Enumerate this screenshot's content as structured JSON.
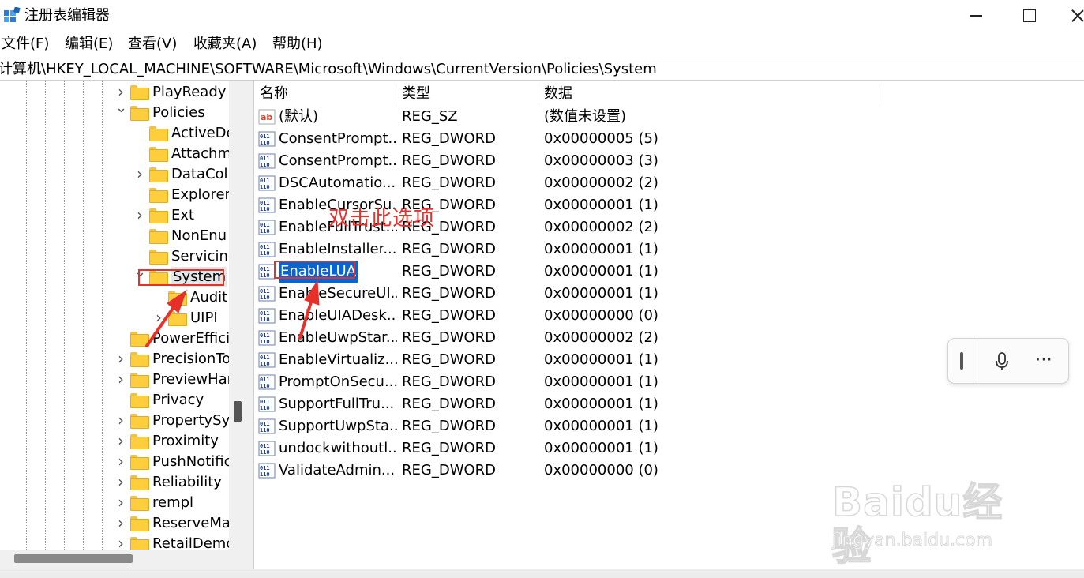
{
  "window": {
    "title": "注册表编辑器"
  },
  "menu": [
    "文件(F)",
    "编辑(E)",
    "查看(V)",
    "收藏夹(A)",
    "帮助(H)"
  ],
  "address": "计算机\\HKEY_LOCAL_MACHINE\\SOFTWARE\\Microsoft\\Windows\\CurrentVersion\\Policies\\System",
  "tree": [
    {
      "label": "PlayReady",
      "level": 0,
      "chevron": "right"
    },
    {
      "label": "Policies",
      "level": 0,
      "chevron": "down"
    },
    {
      "label": "ActiveDe",
      "level": 1,
      "chevron": "none"
    },
    {
      "label": "Attachm",
      "level": 1,
      "chevron": "none"
    },
    {
      "label": "DataCol",
      "level": 1,
      "chevron": "right"
    },
    {
      "label": "Explorer",
      "level": 1,
      "chevron": "none"
    },
    {
      "label": "Ext",
      "level": 1,
      "chevron": "right"
    },
    {
      "label": "NonEnu",
      "level": 1,
      "chevron": "none"
    },
    {
      "label": "Servicing",
      "level": 1,
      "chevron": "none"
    },
    {
      "label": "System",
      "level": 1,
      "chevron": "down",
      "selected": true
    },
    {
      "label": "Audit",
      "level": 2,
      "chevron": "none"
    },
    {
      "label": "UIPI",
      "level": 2,
      "chevron": "right"
    },
    {
      "label": "PowerEffici",
      "level": 0,
      "chevron": "none"
    },
    {
      "label": "PrecisionTo",
      "level": 0,
      "chevron": "right"
    },
    {
      "label": "PreviewHar",
      "level": 0,
      "chevron": "right"
    },
    {
      "label": "Privacy",
      "level": 0,
      "chevron": "none"
    },
    {
      "label": "PropertySy",
      "level": 0,
      "chevron": "right"
    },
    {
      "label": "Proximity",
      "level": 0,
      "chevron": "right"
    },
    {
      "label": "PushNotific",
      "level": 0,
      "chevron": "right"
    },
    {
      "label": "Reliability",
      "level": 0,
      "chevron": "right"
    },
    {
      "label": "rempl",
      "level": 0,
      "chevron": "right"
    },
    {
      "label": "ReserveMa",
      "level": 0,
      "chevron": "right"
    },
    {
      "label": "RetailDemo",
      "level": 0,
      "chevron": "right"
    }
  ],
  "columns": [
    "名称",
    "类型",
    "数据"
  ],
  "values": [
    {
      "name": "(默认)",
      "type": "REG_SZ",
      "data": "(数值未设置)",
      "icon": "string-value-icon"
    },
    {
      "name": "ConsentPrompt...",
      "type": "REG_DWORD",
      "data": "0x00000005 (5)",
      "icon": "dword-value-icon"
    },
    {
      "name": "ConsentPrompt...",
      "type": "REG_DWORD",
      "data": "0x00000003 (3)",
      "icon": "dword-value-icon"
    },
    {
      "name": "DSCAutomatio...",
      "type": "REG_DWORD",
      "data": "0x00000002 (2)",
      "icon": "dword-value-icon"
    },
    {
      "name": "EnableCursorSu...",
      "type": "REG_DWORD",
      "data": "0x00000001 (1)",
      "icon": "dword-value-icon"
    },
    {
      "name": "EnableFullTrust...",
      "type": "REG_DWORD",
      "data": "0x00000002 (2)",
      "icon": "dword-value-icon"
    },
    {
      "name": "EnableInstaller...",
      "type": "REG_DWORD",
      "data": "0x00000001 (1)",
      "icon": "dword-value-icon"
    },
    {
      "name": "EnableLUA",
      "type": "REG_DWORD",
      "data": "0x00000001 (1)",
      "icon": "dword-value-icon",
      "selected": true
    },
    {
      "name": "EnableSecureUI...",
      "type": "REG_DWORD",
      "data": "0x00000001 (1)",
      "icon": "dword-value-icon"
    },
    {
      "name": "EnableUIADesk...",
      "type": "REG_DWORD",
      "data": "0x00000000 (0)",
      "icon": "dword-value-icon"
    },
    {
      "name": "EnableUwpStar...",
      "type": "REG_DWORD",
      "data": "0x00000002 (2)",
      "icon": "dword-value-icon"
    },
    {
      "name": "EnableVirtualiz...",
      "type": "REG_DWORD",
      "data": "0x00000001 (1)",
      "icon": "dword-value-icon"
    },
    {
      "name": "PromptOnSecu...",
      "type": "REG_DWORD",
      "data": "0x00000001 (1)",
      "icon": "dword-value-icon"
    },
    {
      "name": "SupportFullTru...",
      "type": "REG_DWORD",
      "data": "0x00000001 (1)",
      "icon": "dword-value-icon"
    },
    {
      "name": "SupportUwpSta...",
      "type": "REG_DWORD",
      "data": "0x00000001 (1)",
      "icon": "dword-value-icon"
    },
    {
      "name": "undockwithoutl...",
      "type": "REG_DWORD",
      "data": "0x00000001 (1)",
      "icon": "dword-value-icon"
    },
    {
      "name": "ValidateAdmin...",
      "type": "REG_DWORD",
      "data": "0x00000000 (0)",
      "icon": "dword-value-icon"
    }
  ],
  "annotation": {
    "text": "双击此选项",
    "color": "#e8302a"
  },
  "watermark": {
    "brand": "Baidu经验",
    "url": "jingyan.baidu.com"
  },
  "colors": {
    "selection": "#0a64d0",
    "folder": "#ffce3d",
    "annotation": "#e8302a"
  }
}
